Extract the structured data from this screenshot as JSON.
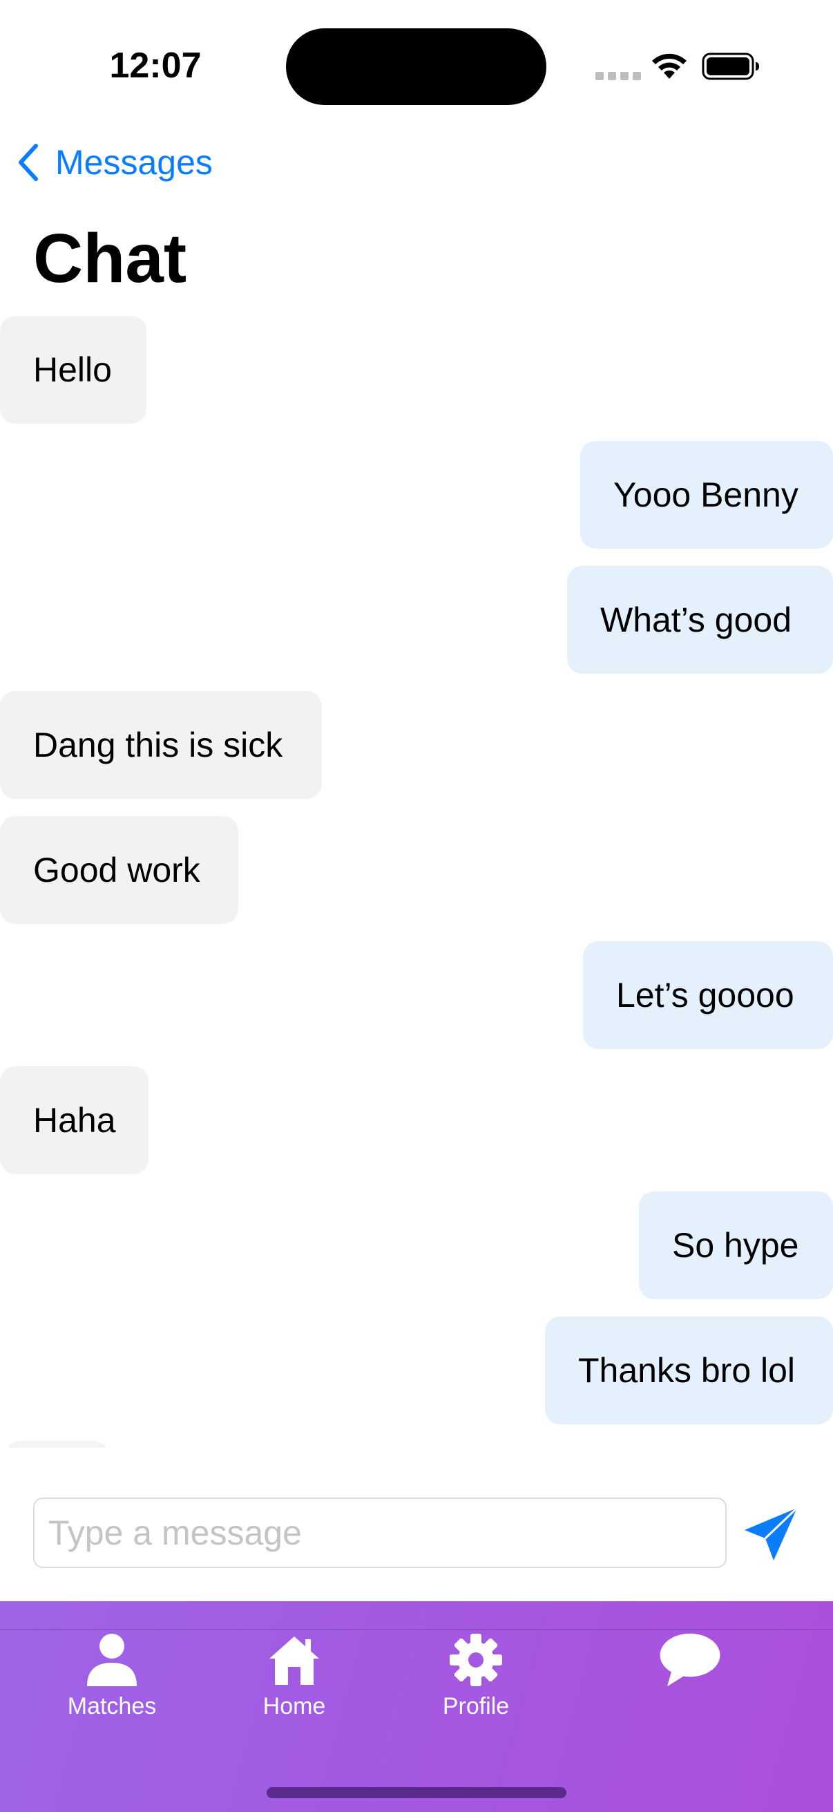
{
  "status_bar": {
    "time": "12:07"
  },
  "nav": {
    "back_label": "Messages",
    "title": "Chat"
  },
  "messages": [
    {
      "text": "Hello",
      "direction": "received"
    },
    {
      "text": "Yooo Benny",
      "direction": "sent"
    },
    {
      "text": "What’s good",
      "direction": "sent"
    },
    {
      "text": "Dang this is sick",
      "direction": "received"
    },
    {
      "text": "Good work",
      "direction": "received"
    },
    {
      "text": "Let’s goooo",
      "direction": "sent"
    },
    {
      "text": "Haha",
      "direction": "received"
    },
    {
      "text": "So hype",
      "direction": "sent"
    },
    {
      "text": "Thanks bro lol",
      "direction": "sent"
    }
  ],
  "composer": {
    "placeholder": "Type a message",
    "value": ""
  },
  "tab_bar": {
    "tabs": [
      {
        "label": "Matches",
        "icon": "person-icon"
      },
      {
        "label": "Home",
        "icon": "house-icon"
      },
      {
        "label": "Profile",
        "icon": "gear-icon"
      },
      {
        "label": "",
        "icon": "chat-bubble-icon"
      }
    ]
  },
  "colors": {
    "accent": "#0a7cff",
    "sent_bubble": "#e5f0fd",
    "received_bubble": "#f2f2f2",
    "tab_bar_gradient_start": "#9f63e6",
    "tab_bar_gradient_end": "#ab4fdc"
  }
}
